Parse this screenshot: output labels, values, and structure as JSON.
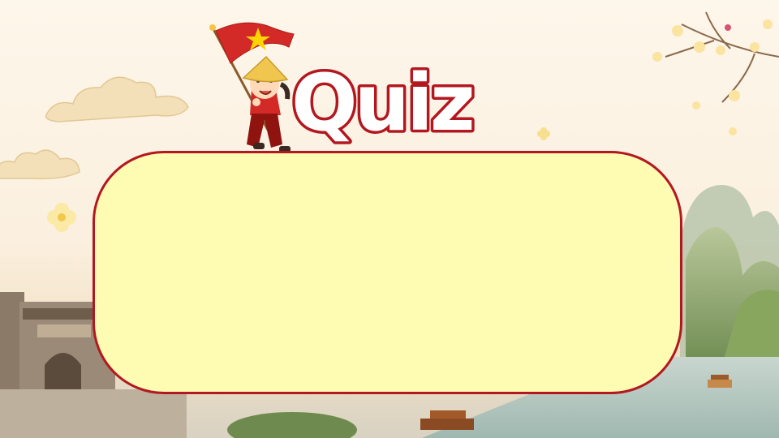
{
  "slide": {
    "title": "Quiz",
    "colors": {
      "title_fill": "#ffffff",
      "title_outline": "#b3171f",
      "box_fill": "#fefbb3",
      "box_border": "#b3171f",
      "flag_red": "#d42a27",
      "flag_star": "#ffd400"
    },
    "decorations": [
      "vietnam-flag",
      "girl-in-conical-hat",
      "apricot-blossom-branch",
      "clouds",
      "limestone-karsts",
      "temple-gate",
      "boats"
    ]
  }
}
